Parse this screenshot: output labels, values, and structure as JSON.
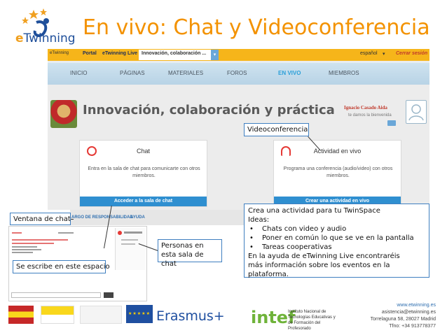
{
  "slide": {
    "title": "En vivo: Chat y Videoconferencia",
    "logo_text_prefix": "e",
    "logo_text_rest": "Twinning"
  },
  "topbar": {
    "tabs": [
      "Portal",
      "eTwinning Live",
      "Innovación, colaboración ..."
    ],
    "language": "español",
    "logout": "Cerrar sesión",
    "brand": "eTwinning"
  },
  "nav": {
    "items": [
      "INICIO",
      "PÁGINAS",
      "MATERIALES",
      "FOROS",
      "EN VIVO",
      "MIEMBROS"
    ],
    "active": "EN VIVO"
  },
  "group": {
    "title": "Innovación, colaboración y práctica",
    "user_name": "Ignacio Casado Aida",
    "welcome": "te damos la bienvenida"
  },
  "chat_card": {
    "title": "Chat",
    "description": "Entra en la sala de chat para comunicarte con otros miembros.",
    "button": "Acceder a la sala de chat"
  },
  "video_card": {
    "title": "Actividad en vivo",
    "description": "Programa una conferencia (audio/video) con otros miembros.",
    "button": "Crear una actividad en vivo"
  },
  "footer_links": [
    "ARGO DE RESPONSABILIDAD",
    "AYUDA"
  ],
  "callouts": {
    "video": "Videoconferencia",
    "window": "Ventana de chat",
    "people_line1": "Personas en",
    "people_line2": "esta sala de chat",
    "write": "Se escribe en este espacio",
    "activity": {
      "line1": "Crea una actividad para tu TwinSpace",
      "line2": "Ideas:",
      "bullets": [
        "Chats con video y audio",
        "Poner en común lo que se ve en la pantalla",
        "Tareas cooperativas"
      ],
      "line3": "En la ayuda de eTwinning Live encontraréis",
      "line4": "más información sobre los eventos en la plataforma."
    }
  },
  "bottom": {
    "erasmus": "Erasmus+",
    "intef": "intef",
    "intef_sub": "Instituto Nacional de Tecnologías Educativas y de Formación del Profesorado",
    "contact": {
      "web": "www.etwinning.es",
      "email": "asistencia@etwinning.es",
      "address": "Torrelaguna 58, 28027 Madrid",
      "phone": "Tfno: +34 913778377"
    }
  },
  "colors": {
    "title_orange": "#f39200",
    "topbar_yellow": "#f6b51a",
    "nav_blue": "#b8d3e6",
    "accent_blue": "#2f8fd0",
    "callout_border": "#3f7fc0"
  }
}
